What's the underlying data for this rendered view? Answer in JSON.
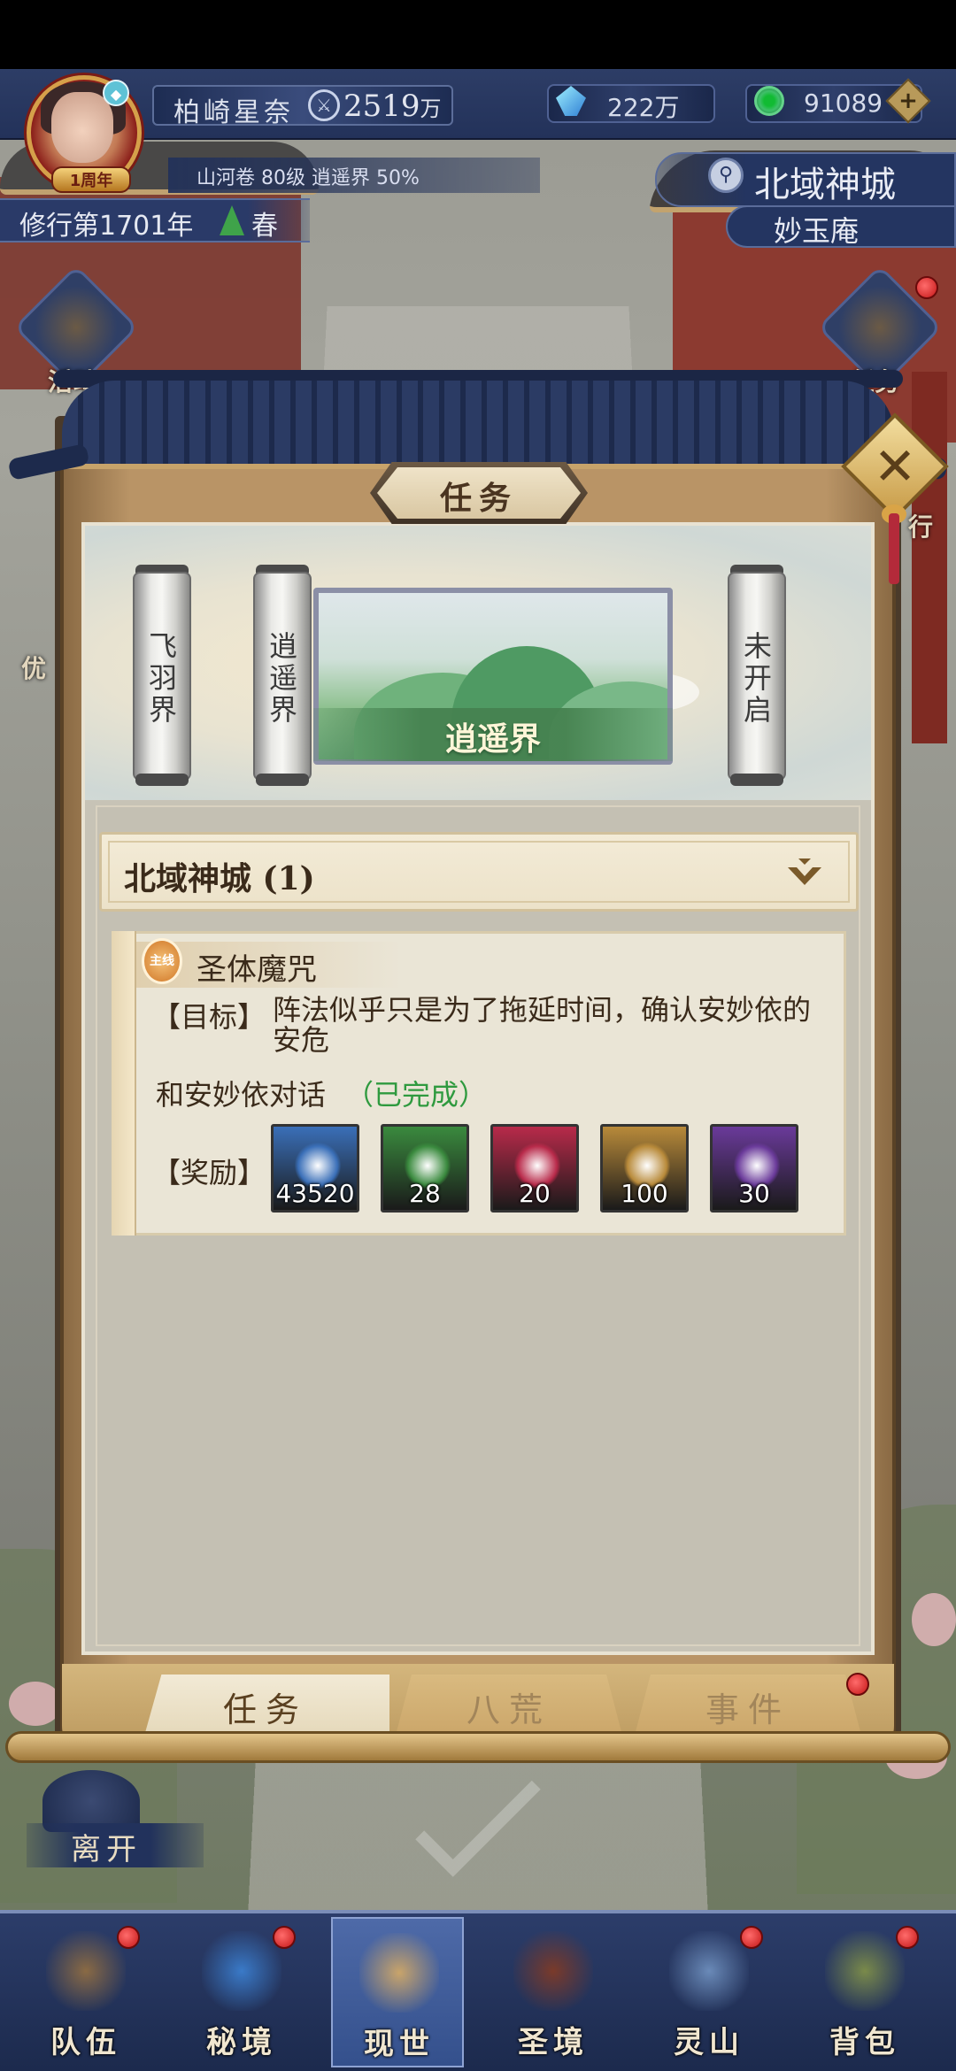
{
  "player": {
    "name": "柏崎星奈",
    "power": "2519",
    "power_unit": "万",
    "anniversary_badge": "1周年",
    "status_line": "山河卷 80级 逍遥界 50%"
  },
  "resources": {
    "crystal": "222万",
    "jade": "91089"
  },
  "cultivation": {
    "year": "修行第1701年",
    "season": "春"
  },
  "location": {
    "city": "北域神城",
    "place": "妙玉庵"
  },
  "side_buttons": {
    "left_top": "活动",
    "left_partial": "优",
    "right_top": "任务",
    "right_partial": "行"
  },
  "modal": {
    "title": "任务",
    "close_icon": "close-x",
    "scrolls": [
      {
        "label": "飞羽界"
      },
      {
        "label": "逍遥界"
      },
      {
        "label": "未开启"
      }
    ],
    "selected_realm": "逍遥界",
    "group": {
      "title": "北域神城 (1)"
    },
    "task": {
      "seal": "主线",
      "title": "圣体魔咒",
      "goal_label": "【目标】",
      "goal_text": "阵法似乎只是为了拖延时间，确认安妙依的安危",
      "objective": "和安妙依对话",
      "objective_status": "（已完成）",
      "reward_label": "【奖励】",
      "rewards": [
        {
          "icon": "crystal-icon",
          "qty": "43520",
          "color": "#3a6fb8"
        },
        {
          "icon": "ore-icon",
          "qty": "28",
          "color": "#3a8a3e"
        },
        {
          "icon": "orb-icon",
          "qty": "20",
          "color": "#b82a4a"
        },
        {
          "icon": "jade-pendant-icon",
          "qty": "100",
          "color": "#b88a3a"
        },
        {
          "icon": "flame-icon",
          "qty": "30",
          "color": "#6a3a9a"
        }
      ]
    },
    "tabs": [
      {
        "label": "任务",
        "active": true
      },
      {
        "label": "八荒",
        "active": false
      },
      {
        "label": "事件",
        "active": false
      }
    ]
  },
  "leave_label": "离开",
  "bottom_nav": [
    {
      "label": "队伍",
      "icon": "team-icon",
      "badge": true
    },
    {
      "label": "秘境",
      "icon": "vortex-icon",
      "badge": true
    },
    {
      "label": "现世",
      "icon": "map-scroll-icon",
      "badge": false,
      "active": true
    },
    {
      "label": "圣境",
      "icon": "pavilion-icon",
      "badge": false
    },
    {
      "label": "灵山",
      "icon": "mountain-icon",
      "badge": true
    },
    {
      "label": "背包",
      "icon": "bag-icon",
      "badge": true
    }
  ]
}
